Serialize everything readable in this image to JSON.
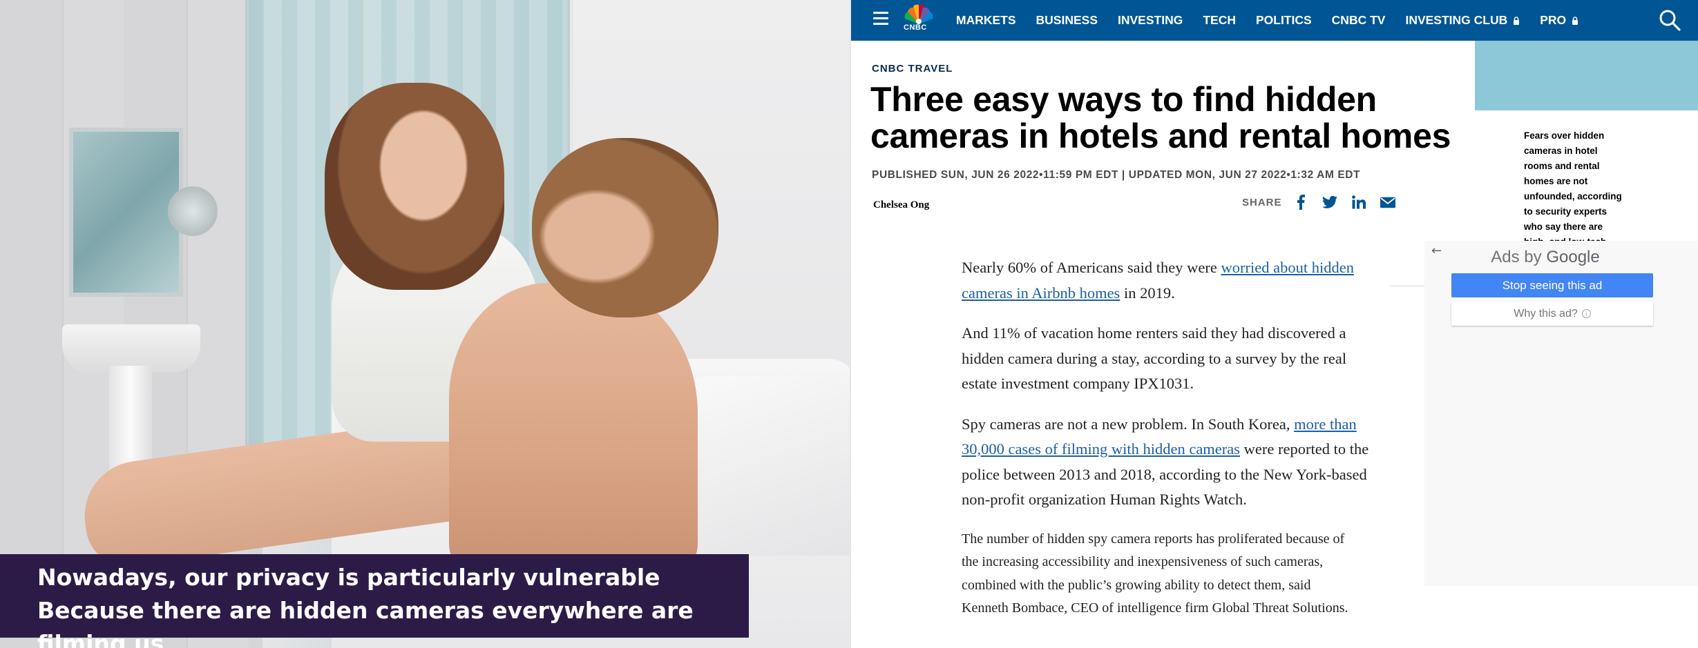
{
  "photo": {
    "caption_line1": "Nowadays, our privacy is particularly vulnerable",
    "caption_line2": "Because there are hidden cameras everywhere are filming us",
    "caption_bg": "#2c1b47"
  },
  "nav": {
    "bg_color": "#005594",
    "logo_text": "CNBC",
    "items": [
      {
        "label": "MARKETS",
        "locked": false
      },
      {
        "label": "BUSINESS",
        "locked": false
      },
      {
        "label": "INVESTING",
        "locked": false
      },
      {
        "label": "TECH",
        "locked": false
      },
      {
        "label": "POLITICS",
        "locked": false
      },
      {
        "label": "CNBC TV",
        "locked": false
      },
      {
        "label": "INVESTING CLUB",
        "locked": true
      },
      {
        "label": "PRO",
        "locked": true
      }
    ],
    "icons": [
      "hamburger-menu-icon",
      "peacock-logo-icon",
      "lock-icon",
      "search-icon"
    ]
  },
  "article": {
    "section": "CNBC TRAVEL",
    "headline": "Three easy ways to find hidden cameras in hotels and rental homes",
    "dateline": "PUBLISHED SUN, JUN 26 2022•11:59 PM EDT | UPDATED MON, JUN 27 2022•1:32 AM EDT",
    "author": "Chelsea Ong",
    "share_label": "SHARE",
    "share_icons": [
      "facebook-icon",
      "twitter-icon",
      "linkedin-icon",
      "email-icon"
    ],
    "p1_pre": "Nearly 60% of Americans said they were ",
    "p1_link": "worried about hidden cameras in Airbnb homes",
    "p1_post": " in 2019.",
    "p2": "And 11% of vacation home renters said they had discovered a hidden camera during a stay, according to a survey by the real estate investment company IPX1031.",
    "p3_pre": "Spy cameras are not a new problem. In South Korea, ",
    "p3_link": "more than 30,000 cases of filming with hidden cameras",
    "p3_post": " were reported to the police between 2013 and 2018, according to the New York-based non-profit organization Human Rights Watch.",
    "p4": "The number of hidden spy camera reports has proliferated because of the increasing accessibility and inexpensiveness of such cameras, combined with the public’s growing ability to detect them, said Kenneth Bombace, CEO of intelligence firm Global Threat Solutions.",
    "link_color": "#1a5fa6"
  },
  "sidebar": {
    "blurb": "Fears over hidden cameras in hotel rooms and rental homes are not unfounded, according to security experts who say there are high- and low-tech ways of finding spy cameras while away from home."
  },
  "ad": {
    "ads_by_prefix": "Ads by ",
    "ads_by_brand": "Google",
    "stop_label": "Stop seeing this ad",
    "why_label": "Why this ad?",
    "stop_color": "#4285f4"
  }
}
